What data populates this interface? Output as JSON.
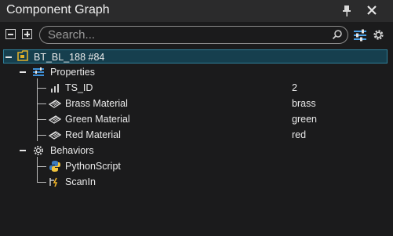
{
  "window": {
    "title": "Component Graph"
  },
  "toolbar": {
    "search_placeholder": "Search..."
  },
  "tree": {
    "root": {
      "label": "BT_BL_188 #84",
      "icon": "component-icon"
    },
    "properties": {
      "label": "Properties",
      "icon": "properties-icon",
      "items": [
        {
          "label": "TS_ID",
          "value": "2",
          "icon": "integer-icon"
        },
        {
          "label": "Brass Material",
          "value": "brass",
          "icon": "material-icon"
        },
        {
          "label": "Green Material",
          "value": "green",
          "icon": "material-icon"
        },
        {
          "label": "Red Material",
          "value": "red",
          "icon": "material-icon"
        }
      ]
    },
    "behaviors": {
      "label": "Behaviors",
      "icon": "gear-icon",
      "items": [
        {
          "label": "PythonScript",
          "icon": "python-icon"
        },
        {
          "label": "ScanIn",
          "icon": "signal-icon"
        }
      ]
    }
  },
  "colors": {
    "background": "#1b1b1c",
    "titlebar": "#2b2b2c",
    "selection": "#163f4e",
    "selection_border": "#2f7f99",
    "component_icon": "#e0b12a",
    "properties_icon": "#3d8fd6"
  }
}
